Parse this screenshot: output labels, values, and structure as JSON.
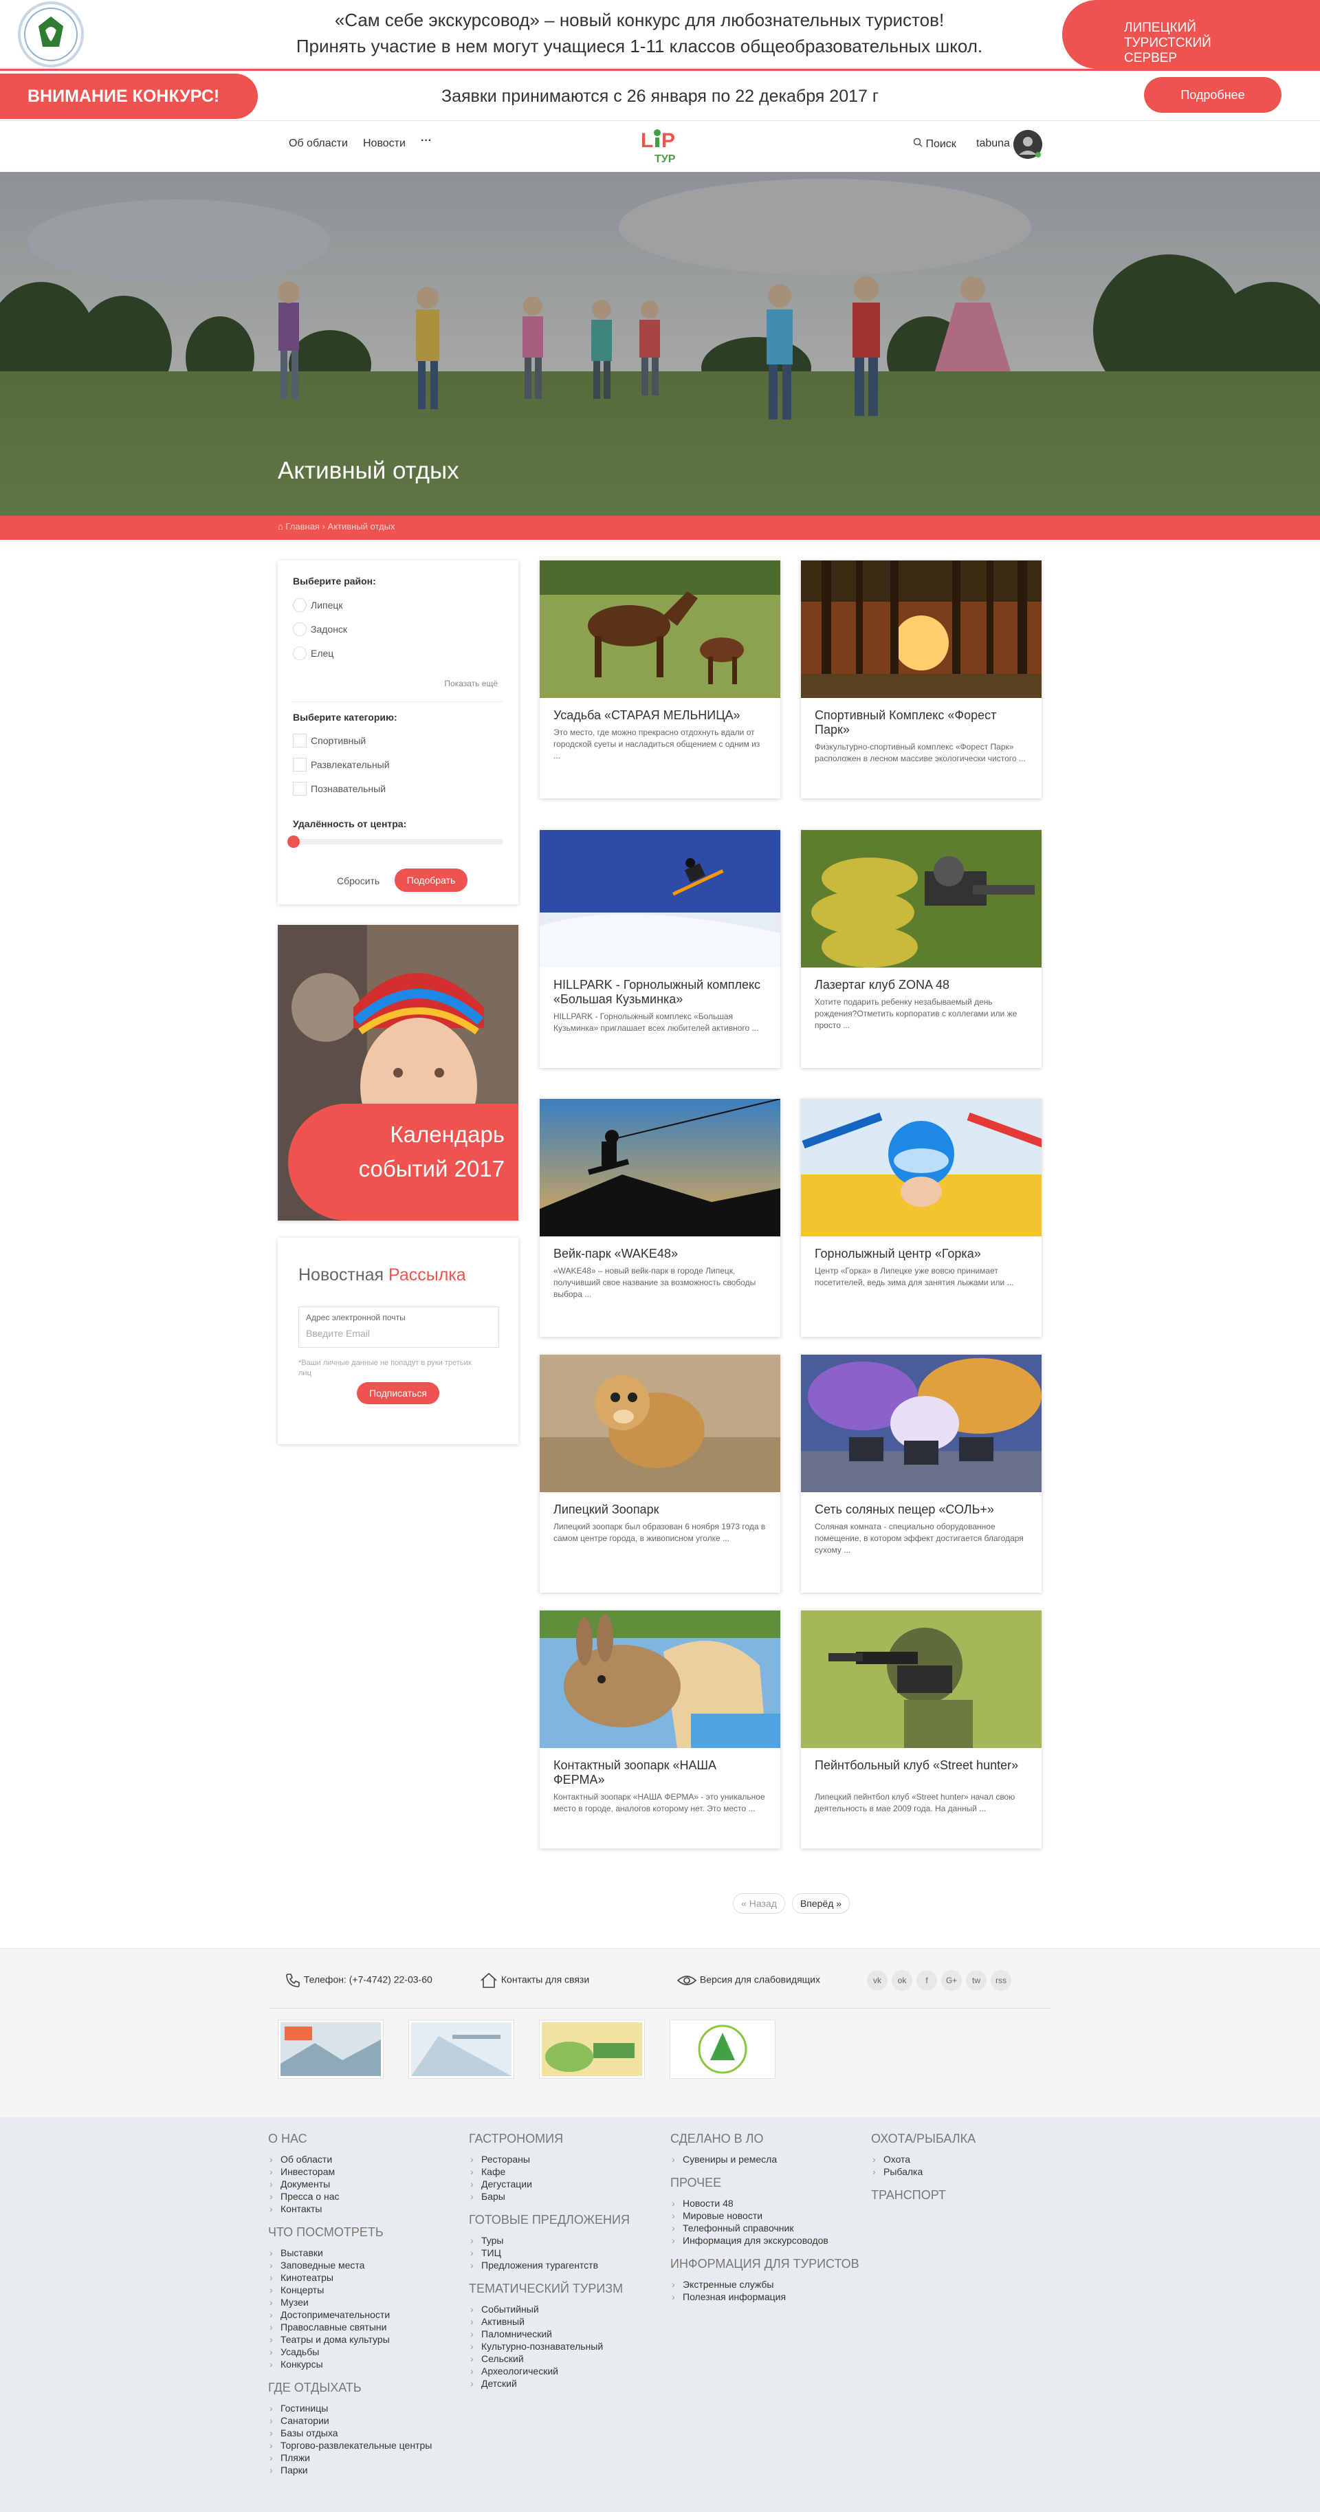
{
  "topbar": {
    "contest_line1": "«Сам себе экскурсовод» – новый конкурс для любознательных туристов!",
    "contest_line2": "Принять участие в нем могут учащиеся 1-11 классов общеобразовательных школ.",
    "server_label": "ЛИПЕЦКИЙ ТУРИСТСКИЙ СЕРВЕР"
  },
  "announcement": {
    "attention": "ВНИМАНИЕ КОНКУРС!",
    "dates": "Заявки принимаются с 26 января по 22 декабря 2017 г",
    "more": "Подробнее"
  },
  "nav": {
    "items": [
      "Об области",
      "Новости",
      "···"
    ],
    "search": "Поиск",
    "user": "tabuna"
  },
  "hero": {
    "title": "Активный отдых",
    "breadcrumb_home": "Главная",
    "breadcrumb_current": "Активный отдых"
  },
  "filters": {
    "district_label": "Выберите район:",
    "districts": [
      "Липецк",
      "Задонск",
      "Елец"
    ],
    "show_more": "Показать ещё",
    "category_label": "Выберите категорию:",
    "categories": [
      "Спортивный",
      "Развлекательный",
      "Познавательный"
    ],
    "distance_label": "Удалённость от центра:",
    "distance_value": 0,
    "reset": "Сбросить",
    "apply": "Подобрать"
  },
  "calendar": {
    "line1": "Календарь",
    "line2": "событий 2017"
  },
  "newsletter": {
    "title_a": "Новостная",
    "title_b": "Рассылка",
    "field_label": "Адрес электронной почты",
    "placeholder": "Введите Email",
    "note": "*Ваши личные данные не попадут в руки третьих лиц",
    "subscribe": "Подписаться"
  },
  "cards": [
    {
      "title": "Усадьба «СТАРАЯ МЕЛЬНИЦА»",
      "desc": "Это место, где можно прекрасно отдохнуть вдали от городской суеты и насладиться общением с одним из ..."
    },
    {
      "title": "Спортивный Комплекс «Форест Парк»",
      "desc": "Физкультурно-спортивный комплекс «Форест Парк» расположен в лесном массиве экологически чистого ..."
    },
    {
      "title": "HILLPARK - Горнолыжный комплекс «Большая Кузьминка»",
      "desc": "HILLPARK - Горнолыжный комплекс «Большая Кузьминка» приглашает всех любителей активного ..."
    },
    {
      "title": "Лазертаг клуб ZONA 48",
      "desc": "Хотите подарить ребенку незабываемый день рождения?Отметить корпоратив с коллегами или же просто ..."
    },
    {
      "title": "Вейк-парк «WAKE48»",
      "desc": "«WAKE48» – новый вейк-парк в городе Липецк, получивший свое название за возможность свободы выбора ..."
    },
    {
      "title": "Горнолыжный центр «Горка»",
      "desc": "Центр «Горка» в Липецке уже вовсю принимает посетителей, ведь зима для занятия лыжами или ..."
    },
    {
      "title": "Липецкий Зоопарк",
      "desc": "Липецкий зоопарк был образован 6 ноября 1973 года в самом центре города, в живописном уголке ..."
    },
    {
      "title": "Сеть соляных пещер «СОЛЬ+»",
      "desc": "Соляная комната - специально оборудованное помещение, в котором эффект достигается благодаря сухому ..."
    },
    {
      "title": "Контактный зоопарк «НАША ФЕРМА»",
      "desc": "Контактный зоопарк «НАША ФЕРМА» - это уникальное место в городе, аналогов которому нет. Это место ..."
    },
    {
      "title": "Пейнтбольный клуб «Street hunter»",
      "desc": "Липецкий пейнтбол клуб «Street hunter» начал свою деятельность в мае 2009 года. На данный ..."
    }
  ],
  "pagination": {
    "prev": "« Назад",
    "next": "Вперёд »"
  },
  "contacts": {
    "phone": "Телефон: (+7-4742) 22-03-60",
    "contact": "Контакты для связи",
    "accessible": "Версия для слабовидящих",
    "social": [
      "vk",
      "ok",
      "f",
      "G+",
      "tw",
      "rss"
    ]
  },
  "footer": {
    "col1": [
      {
        "head": "О нас",
        "items": [
          "Об области",
          "Инвесторам",
          "Документы",
          "Пресса о нас",
          "Контакты"
        ]
      },
      {
        "head": "Что посмотреть",
        "items": [
          "Выставки",
          "Заповедные места",
          "Кинотеатры",
          "Концерты",
          "Музеи",
          "Достопримечательности",
          "Православные святыни",
          "Театры и дома культуры",
          "Усадьбы",
          "Конкурсы"
        ]
      },
      {
        "head": "Где отдыхать",
        "items": [
          "Гостиницы",
          "Санатории",
          "Базы отдыха",
          "Торгово-развлекательные центры",
          "Пляжи",
          "Парки"
        ]
      }
    ],
    "col2": [
      {
        "head": "Гастрономия",
        "items": [
          "Рестораны",
          "Кафе",
          "Дегустации",
          "Бары"
        ]
      },
      {
        "head": "Готовые предложения",
        "items": [
          "Туры",
          "ТИЦ",
          "Предложения турагентств"
        ]
      },
      {
        "head": "Тематический туризм",
        "items": [
          "Событийный",
          "Активный",
          "Паломнический",
          "Культурно-познавательный",
          "Сельский",
          "Археологический",
          "Детский"
        ]
      }
    ],
    "col3": [
      {
        "head": "Сделано в ЛО",
        "items": [
          "Сувениры и ремесла"
        ]
      },
      {
        "head": "Прочее",
        "items": [
          "Новости 48",
          "Мировые новости",
          "Телефонный справочник",
          "Информация для экскурсоводов"
        ]
      },
      {
        "head": "Информация для туристов",
        "items": [
          "Экстренные службы",
          "Полезная информация"
        ]
      }
    ],
    "col4": [
      {
        "head": "Охота/Рыбалка",
        "items": [
          "Охота",
          "Рыбалка"
        ]
      },
      {
        "head": "Транспорт",
        "items": []
      }
    ]
  },
  "colors": {
    "accent": "#ef5350",
    "footer_bg": "#e9ecef"
  }
}
